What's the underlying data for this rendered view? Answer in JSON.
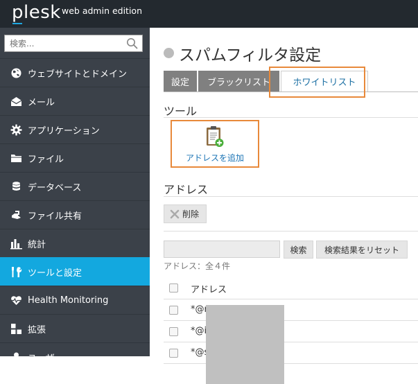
{
  "brand": {
    "logo": "plesk",
    "edition": "web admin edition",
    "accent": "#1ea7e1"
  },
  "sidebar": {
    "search_placeholder": "検索...",
    "items": [
      {
        "label": "ウェブサイトとドメイン",
        "icon": "globe-icon"
      },
      {
        "label": "メール",
        "icon": "mail-icon"
      },
      {
        "label": "アプリケーション",
        "icon": "gear-icon"
      },
      {
        "label": "ファイル",
        "icon": "folder-icon"
      },
      {
        "label": "データベース",
        "icon": "database-icon"
      },
      {
        "label": "ファイル共有",
        "icon": "file-share-icon"
      },
      {
        "label": "統計",
        "icon": "bar-chart-icon"
      },
      {
        "label": "ツールと設定",
        "icon": "tools-icon",
        "active": true
      },
      {
        "label": "Health Monitoring",
        "icon": "heart-pulse-icon"
      },
      {
        "label": "拡張",
        "icon": "extensions-icon"
      },
      {
        "label": "ユーザ",
        "icon": "user-icon"
      }
    ],
    "active_color": "#13a8df"
  },
  "main": {
    "title": "スパムフィルタ設定",
    "tabs": [
      {
        "label": "設定"
      },
      {
        "label": "ブラックリスト"
      },
      {
        "label": "ホワイトリスト",
        "active": true
      }
    ],
    "tools_heading": "ツール",
    "add_address_label": "アドレスを追加",
    "address_heading": "アドレス",
    "delete_label": "削除",
    "filter": {
      "value": "",
      "search_label": "検索",
      "reset_label": "検索結果をリセット"
    },
    "count_text": "アドレス：全４件",
    "table": {
      "header": "アドレス",
      "rows": [
        "*@r",
        "*@i",
        "*@s"
      ]
    }
  },
  "highlight_color": "#e8893a"
}
